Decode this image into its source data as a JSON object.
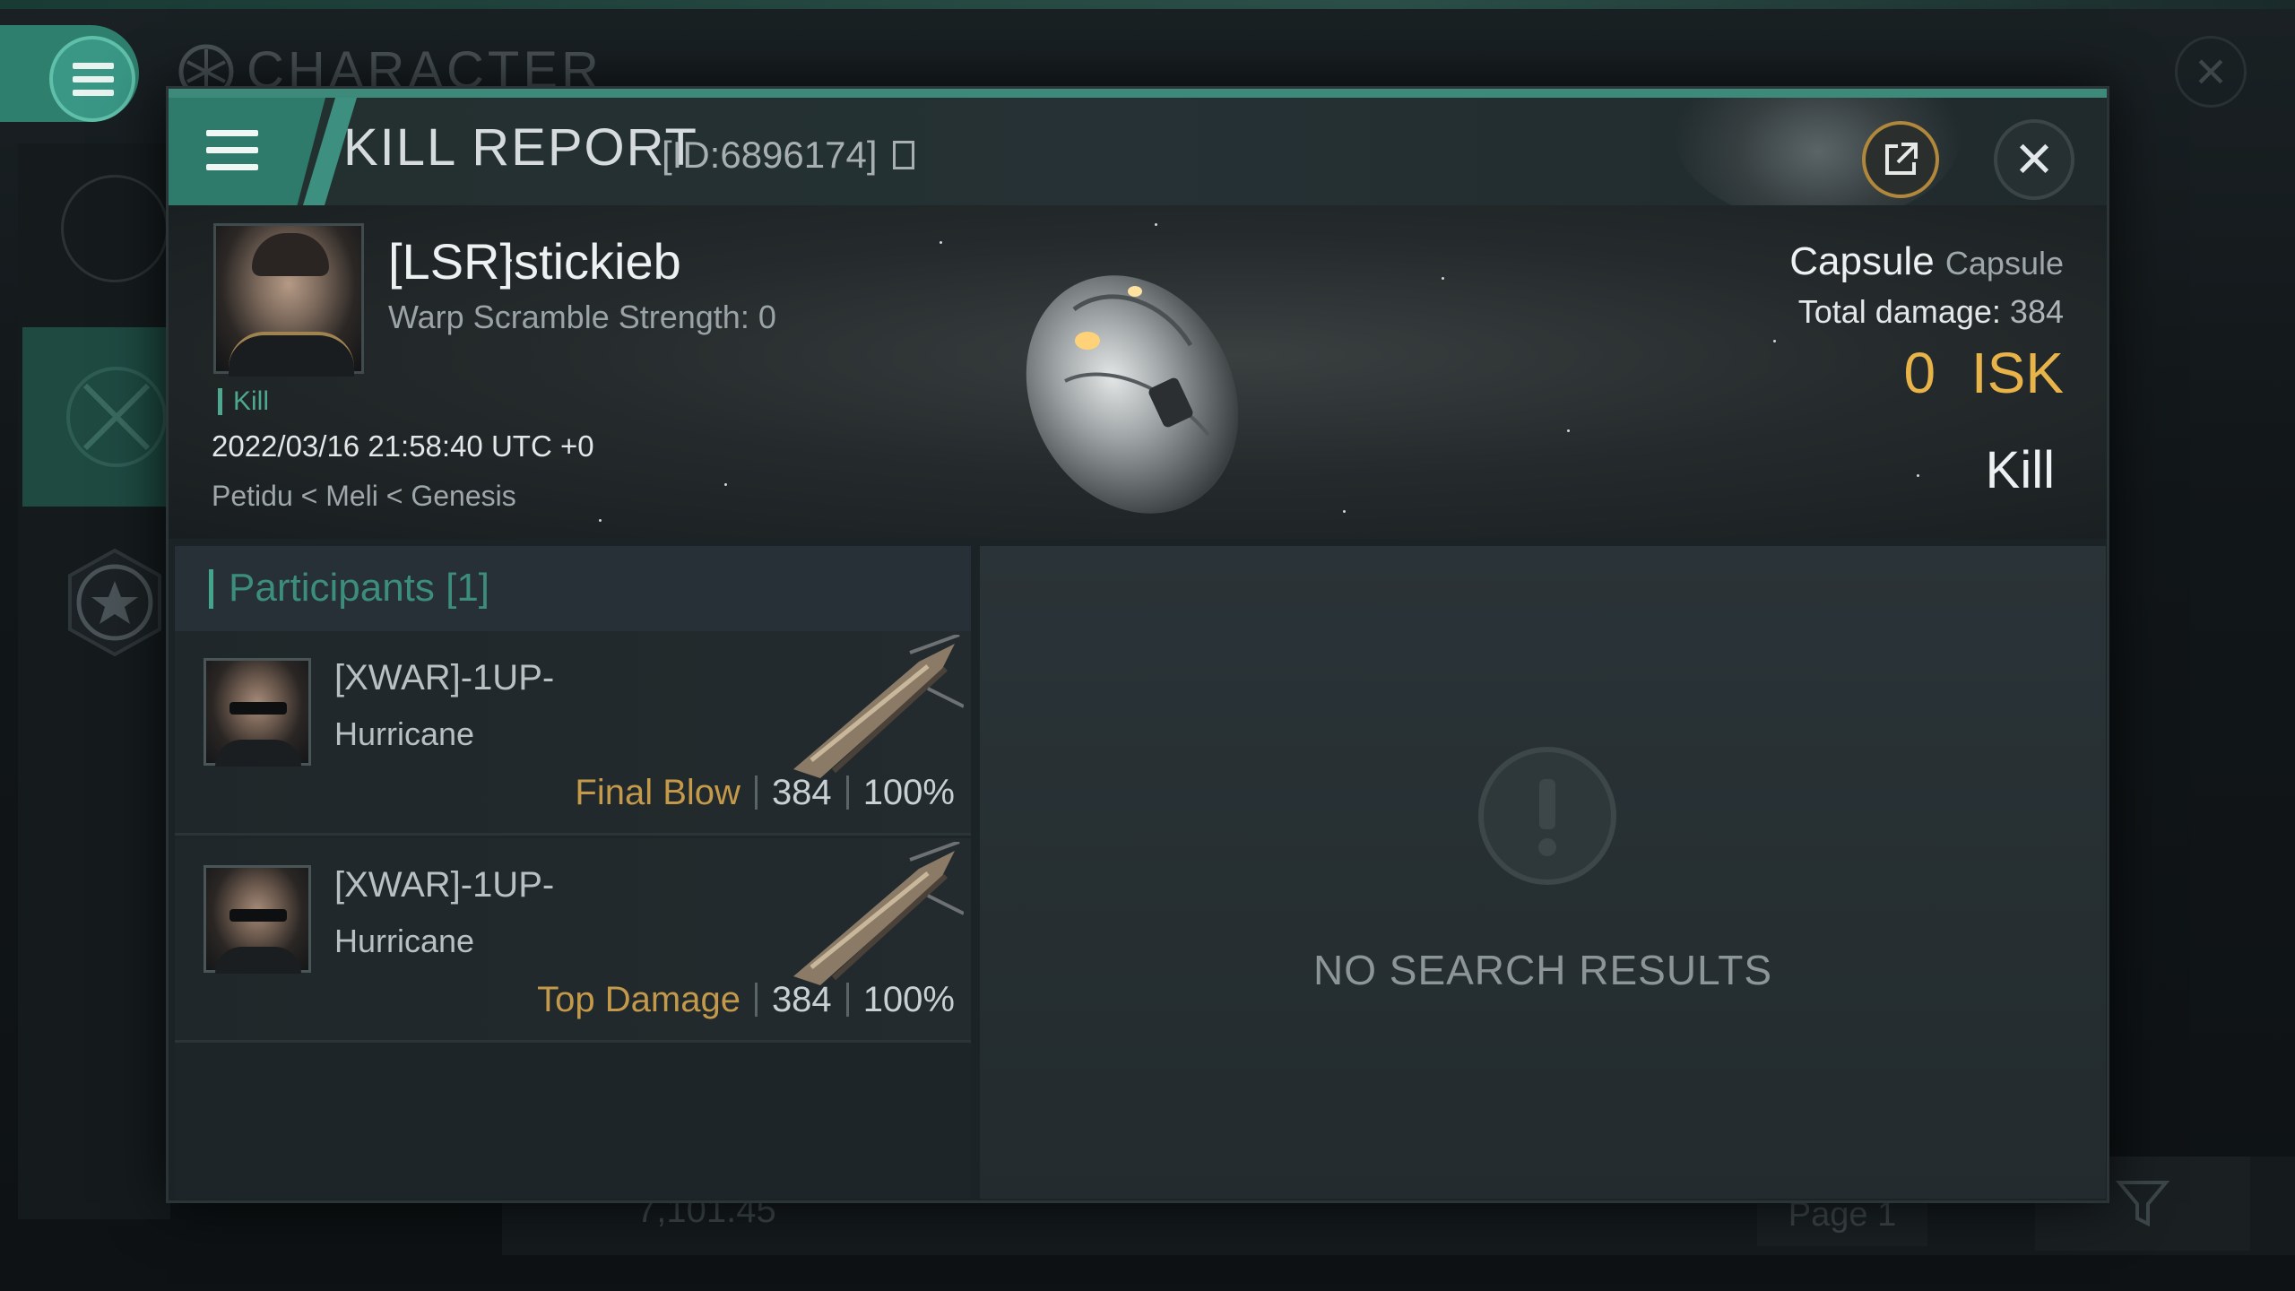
{
  "background": {
    "title": "CHARACTER",
    "footer_value": "7,101.45",
    "page_label": "Page 1"
  },
  "header": {
    "title": "KILL REPORT",
    "report_id": "[ID:6896174]"
  },
  "victim": {
    "name": "[LSR]stickieb",
    "warp_scramble": "Warp Scramble Strength: 0",
    "tag": "Kill",
    "datetime": "2022/03/16 21:58:40 UTC +0",
    "location": "Petidu < Meli < Genesis",
    "ship_name": "Capsule",
    "ship_class": "Capsule",
    "total_damage_label": "Total damage:",
    "total_damage": "384",
    "isk_value": "0",
    "isk_unit": "ISK",
    "verdict": "Kill"
  },
  "participants": {
    "title": "Participants [1]",
    "rows": [
      {
        "name": "[XWAR]-1UP-",
        "ship": "Hurricane",
        "label": "Final Blow",
        "damage": "384",
        "percent": "100%"
      },
      {
        "name": "[XWAR]-1UP-",
        "ship": "Hurricane",
        "label": "Top Damage",
        "damage": "384",
        "percent": "100%"
      }
    ]
  },
  "results": {
    "empty_text": "NO SEARCH RESULTS"
  },
  "colors": {
    "accent": "#3d8a7a",
    "gold": "#e8b44a",
    "label_gold": "#c49a4a"
  }
}
